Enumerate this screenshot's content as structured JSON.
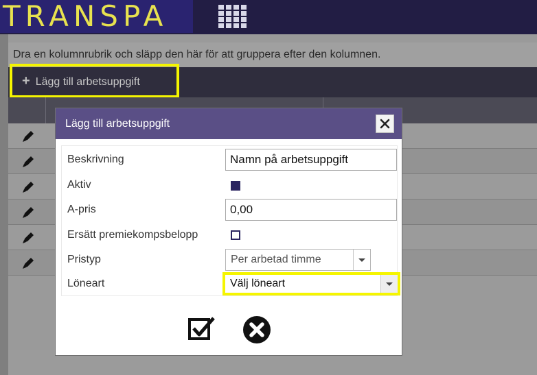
{
  "app": {
    "logo": "TRANSPA",
    "apps_icon": "grid-apps-icon"
  },
  "grid": {
    "group_hint": "Dra en kolumnrubrik och släpp den här för att gruppera efter den kolumnen.",
    "add_button": {
      "icon": "plus-icon",
      "label": "Lägg till arbetsuppgift"
    },
    "row_count": 6,
    "row_icon": "pencil-icon"
  },
  "dialog": {
    "title": "Lägg till arbetsuppgift",
    "close_icon": "close-icon",
    "fields": {
      "description": {
        "label": "Beskrivning",
        "value": "Namn på arbetsuppgift"
      },
      "active": {
        "label": "Aktiv",
        "checked": true
      },
      "unit_price": {
        "label": "A-pris",
        "value": "0,00"
      },
      "replace_bonus": {
        "label": "Ersätt premiekompsbelopp",
        "checked": false
      },
      "price_type": {
        "label": "Pristyp",
        "value": "Per arbetad timme"
      },
      "wage_type": {
        "label": "Löneart",
        "value": "Välj löneart"
      }
    },
    "actions": {
      "confirm_icon": "checkmark-save-icon",
      "cancel_icon": "cancel-x-icon"
    }
  },
  "colors": {
    "highlight": "#f5f500",
    "dialog_header": "#5a4f86",
    "logo_text": "#e8e24f"
  }
}
